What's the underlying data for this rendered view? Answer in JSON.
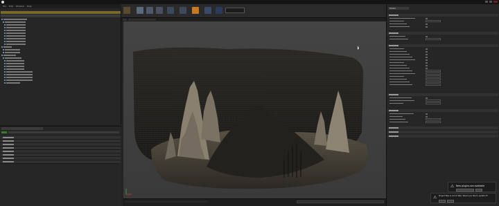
{
  "menu": [
    "File",
    "Edit",
    "Window",
    "Help"
  ],
  "right_tab": "Details",
  "notifications": [
    {
      "title": "New plugins are available"
    },
    {
      "title": "Project files is out of date. Would you like to update it?"
    }
  ]
}
